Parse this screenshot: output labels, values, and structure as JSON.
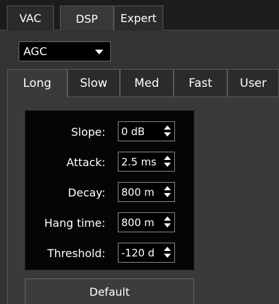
{
  "top_tabs": [
    "VAC",
    "DSP",
    "Expert"
  ],
  "active_top_tab": "DSP",
  "mode_select": {
    "value": "AGC"
  },
  "sub_tabs": [
    "Long",
    "Slow",
    "Med",
    "Fast",
    "User"
  ],
  "active_sub_tab": "Long",
  "settings": [
    {
      "label": "Slope:",
      "value": "0 dB"
    },
    {
      "label": "Attack:",
      "value": "2.5 ms"
    },
    {
      "label": "Decay:",
      "value": "800 m"
    },
    {
      "label": "Hang time:",
      "value": "800 m"
    },
    {
      "label": "Threshold:",
      "value": "-120 d"
    }
  ],
  "default_button": "Default",
  "colors": {
    "background": "#1c1c1c",
    "panel": "#333333",
    "settings_box": "#050505",
    "text": "#ffffff"
  }
}
